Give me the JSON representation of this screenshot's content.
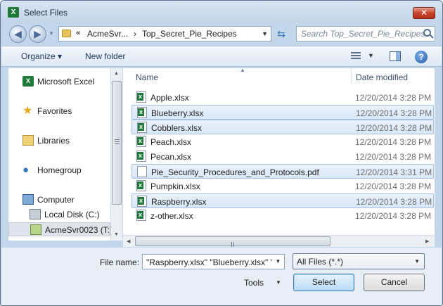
{
  "window": {
    "title": "Select Files",
    "app_icon": "excel-icon"
  },
  "address": {
    "breadcrumb_prefix": "«",
    "crumbs": [
      "AcmeSvr...",
      "Top_Secret_Pie_Recipes"
    ],
    "separator": "›",
    "search_placeholder": "Search Top_Secret_Pie_Recipes"
  },
  "toolbar": {
    "organize_label": "Organize ▾",
    "new_folder_label": "New folder"
  },
  "nav": {
    "items": [
      {
        "label": "Microsoft Excel",
        "icon": "excel-icon"
      },
      {
        "label": "Favorites",
        "icon": "star-icon"
      },
      {
        "label": "Libraries",
        "icon": "library-icon"
      },
      {
        "label": "Homegroup",
        "icon": "homegroup-icon"
      },
      {
        "label": "Computer",
        "icon": "computer-icon"
      },
      {
        "label": "Local Disk (C:)",
        "icon": "disk-icon"
      },
      {
        "label": "AcmeSvr0023 (T:)",
        "icon": "network-drive-icon",
        "selected": true
      }
    ]
  },
  "files": {
    "headers": {
      "name": "Name",
      "date": "Date modified"
    },
    "rows": [
      {
        "name": "Apple.xlsx",
        "date": "12/20/2014 3:28 PM",
        "type": "xlsx",
        "selected": false
      },
      {
        "name": "Blueberry.xlsx",
        "date": "12/20/2014 3:28 PM",
        "type": "xlsx",
        "selected": true
      },
      {
        "name": "Cobblers.xlsx",
        "date": "12/20/2014 3:28 PM",
        "type": "xlsx",
        "selected": true
      },
      {
        "name": "Peach.xlsx",
        "date": "12/20/2014 3:28 PM",
        "type": "xlsx",
        "selected": false
      },
      {
        "name": "Pecan.xlsx",
        "date": "12/20/2014 3:28 PM",
        "type": "xlsx",
        "selected": false
      },
      {
        "name": "Pie_Security_Procedures_and_Protocols.pdf",
        "date": "12/20/2014 3:31 PM",
        "type": "pdf",
        "selected": true
      },
      {
        "name": "Pumpkin.xlsx",
        "date": "12/20/2014 3:28 PM",
        "type": "xlsx",
        "selected": false
      },
      {
        "name": "Raspberry.xlsx",
        "date": "12/20/2014 3:28 PM",
        "type": "xlsx",
        "selected": true
      },
      {
        "name": "z-other.xlsx",
        "date": "12/20/2014 3:28 PM",
        "type": "xlsx",
        "selected": false
      }
    ]
  },
  "bottom": {
    "file_name_label": "File name:",
    "file_name_value": "\"Raspberry.xlsx\" \"Blueberry.xlsx\" \"C",
    "file_type_value": "All Files (*.*)",
    "tools_label": "Tools",
    "select_label": "Select",
    "cancel_label": "Cancel"
  }
}
